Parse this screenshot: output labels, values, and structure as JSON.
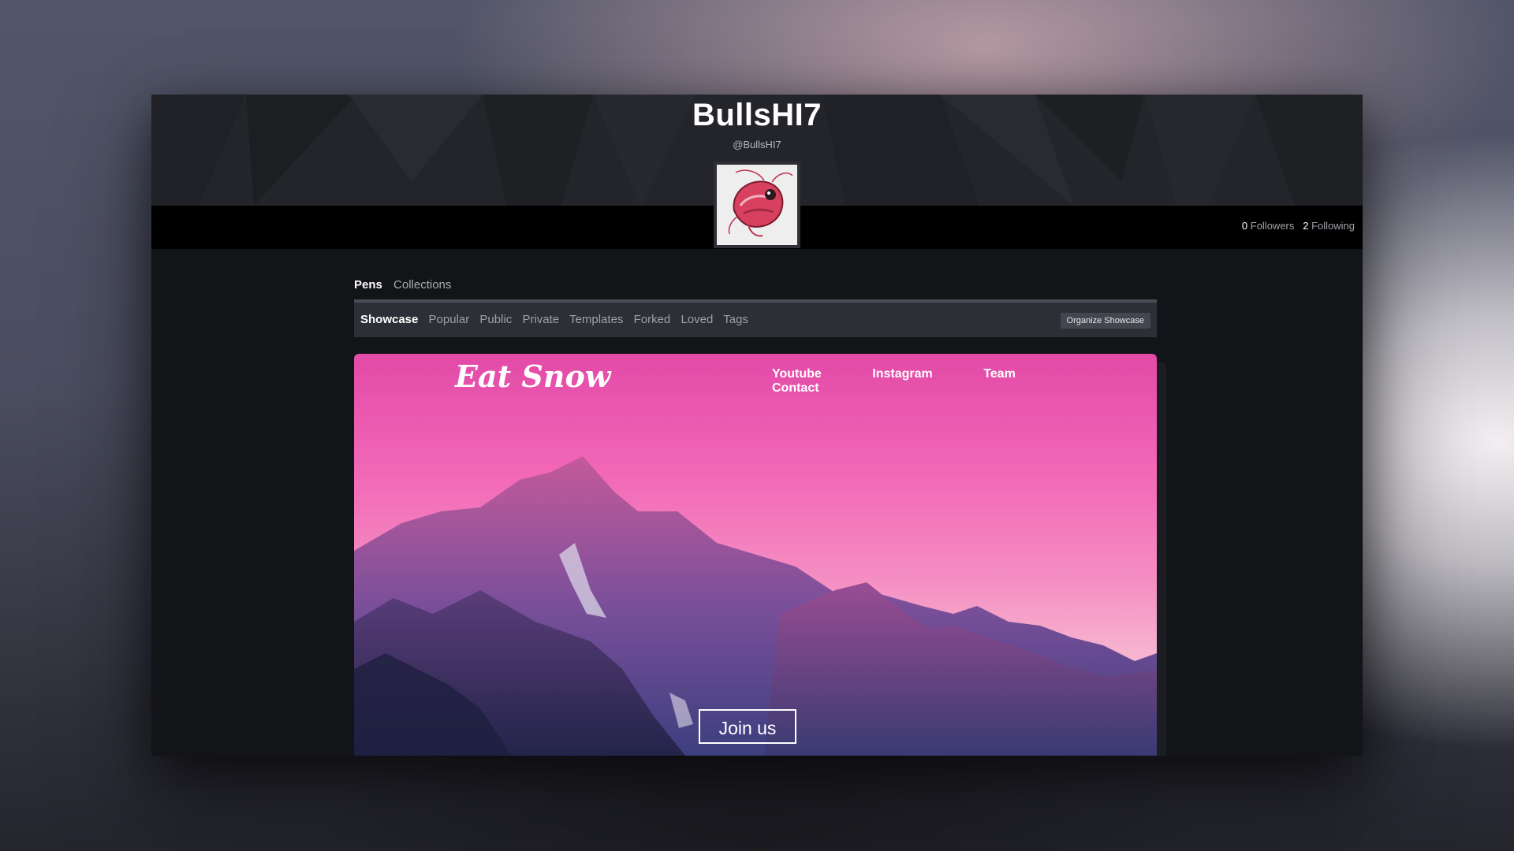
{
  "profile": {
    "username": "BullsHI7",
    "handle": "@BullsHI7",
    "followers_count": "0",
    "followers_label": "Followers",
    "following_count": "2",
    "following_label": "Following"
  },
  "tabs": [
    {
      "label": "Pens",
      "active": true
    },
    {
      "label": "Collections",
      "active": false
    }
  ],
  "subnav": [
    {
      "label": "Showcase",
      "active": true
    },
    {
      "label": "Popular"
    },
    {
      "label": "Public"
    },
    {
      "label": "Private"
    },
    {
      "label": "Templates"
    },
    {
      "label": "Forked"
    },
    {
      "label": "Loved"
    },
    {
      "label": "Tags"
    }
  ],
  "organize_button": "Organize Showcase",
  "preview": {
    "brand": "Eat Snow",
    "nav": [
      "Youtube",
      "Instagram",
      "Team",
      "Contact"
    ],
    "cta": "Join us"
  },
  "colors": {
    "page_bg": "#131417",
    "header_bg": "#24252a",
    "subbar_bg": "#2c2f36",
    "preview_sky_top": "#e24aa7",
    "preview_sky_bottom": "#f3d0d8"
  }
}
